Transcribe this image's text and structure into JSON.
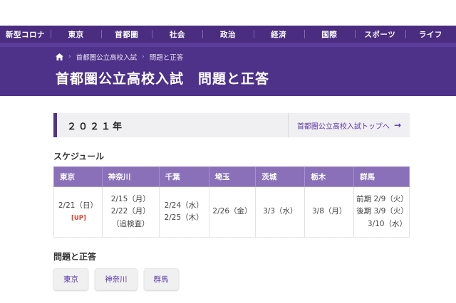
{
  "nav": {
    "items": [
      {
        "label": "新型コロナ"
      },
      {
        "label": "東京"
      },
      {
        "label": "首都圏"
      },
      {
        "label": "社会"
      },
      {
        "label": "政治"
      },
      {
        "label": "経済"
      },
      {
        "label": "国際"
      },
      {
        "label": "スポーツ"
      },
      {
        "label": "ライフ"
      }
    ]
  },
  "breadcrumb": {
    "separator": "›",
    "items": [
      "首都圏公立高校入試",
      "問題と正答"
    ]
  },
  "page": {
    "title": "首都圏公立高校入試　問題と正答"
  },
  "year_box": {
    "year": "２０２１年",
    "link_label": "首都圏公立高校入試トップへ",
    "arrow": "→"
  },
  "schedule": {
    "heading": "スケジュール",
    "table": {
      "headers": [
        "東京",
        "神奈川",
        "千葉",
        "埼玉",
        "茨城",
        "栃木",
        "群馬"
      ],
      "row": [
        {
          "lines": [
            "2/21（日）"
          ],
          "badge": "[UP]"
        },
        {
          "lines": [
            "2/15（月）",
            "2/22（月）",
            "（追検査）"
          ]
        },
        {
          "lines": [
            "2/24（水）",
            "2/25（木）"
          ]
        },
        {
          "lines": [
            "2/26（金）"
          ]
        },
        {
          "lines": [
            "3/3（水）"
          ]
        },
        {
          "lines": [
            "3/8（月）"
          ]
        },
        {
          "lines": [
            "前期 2/9（火）",
            "後期 3/9（火）",
            "3/10（水）"
          ]
        }
      ]
    }
  },
  "answers": {
    "heading": "問題と正答",
    "buttons": [
      "東京",
      "神奈川",
      "群馬"
    ]
  },
  "colors": {
    "nav_bg": "#4a2c80",
    "band": "#5c3f9c",
    "header_bg": "#4e3189",
    "table_header_bg": "#8a70b9",
    "accent": "#5b3aa6",
    "up_badge": "#e03a2a",
    "year_box_bg": "#f0eff2",
    "year_box_border": "#52318f"
  }
}
